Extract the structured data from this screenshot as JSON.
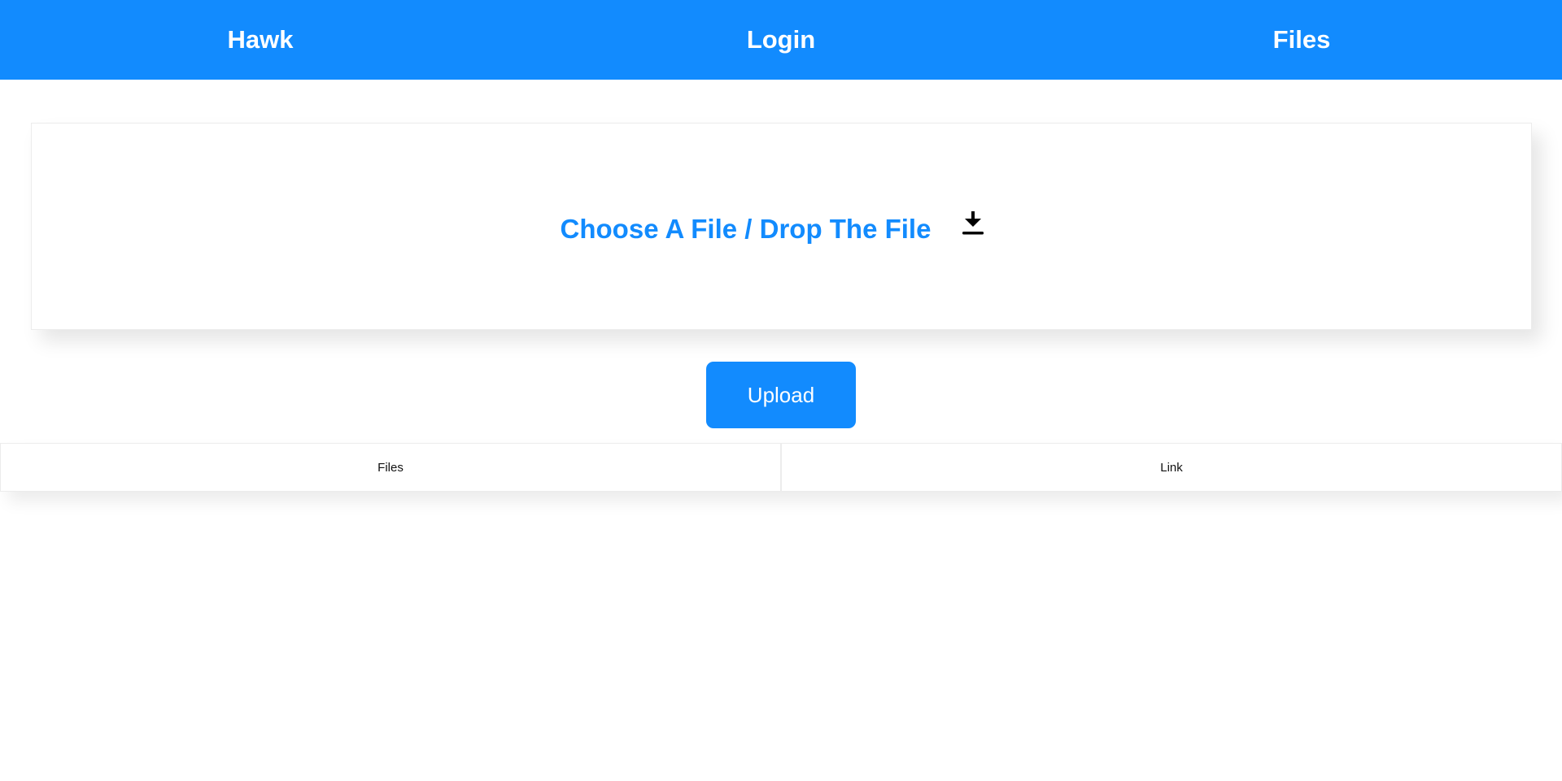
{
  "navbar": {
    "brand": "Hawk",
    "login": "Login",
    "files": "Files"
  },
  "dropzone": {
    "label": "Choose A File / Drop The File",
    "icon": "download-icon"
  },
  "upload": {
    "label": "Upload"
  },
  "table": {
    "columns": [
      "Files",
      "Link"
    ]
  },
  "colors": {
    "accent": "#128bfe",
    "background": "#ffffff",
    "icon": "#000000"
  }
}
